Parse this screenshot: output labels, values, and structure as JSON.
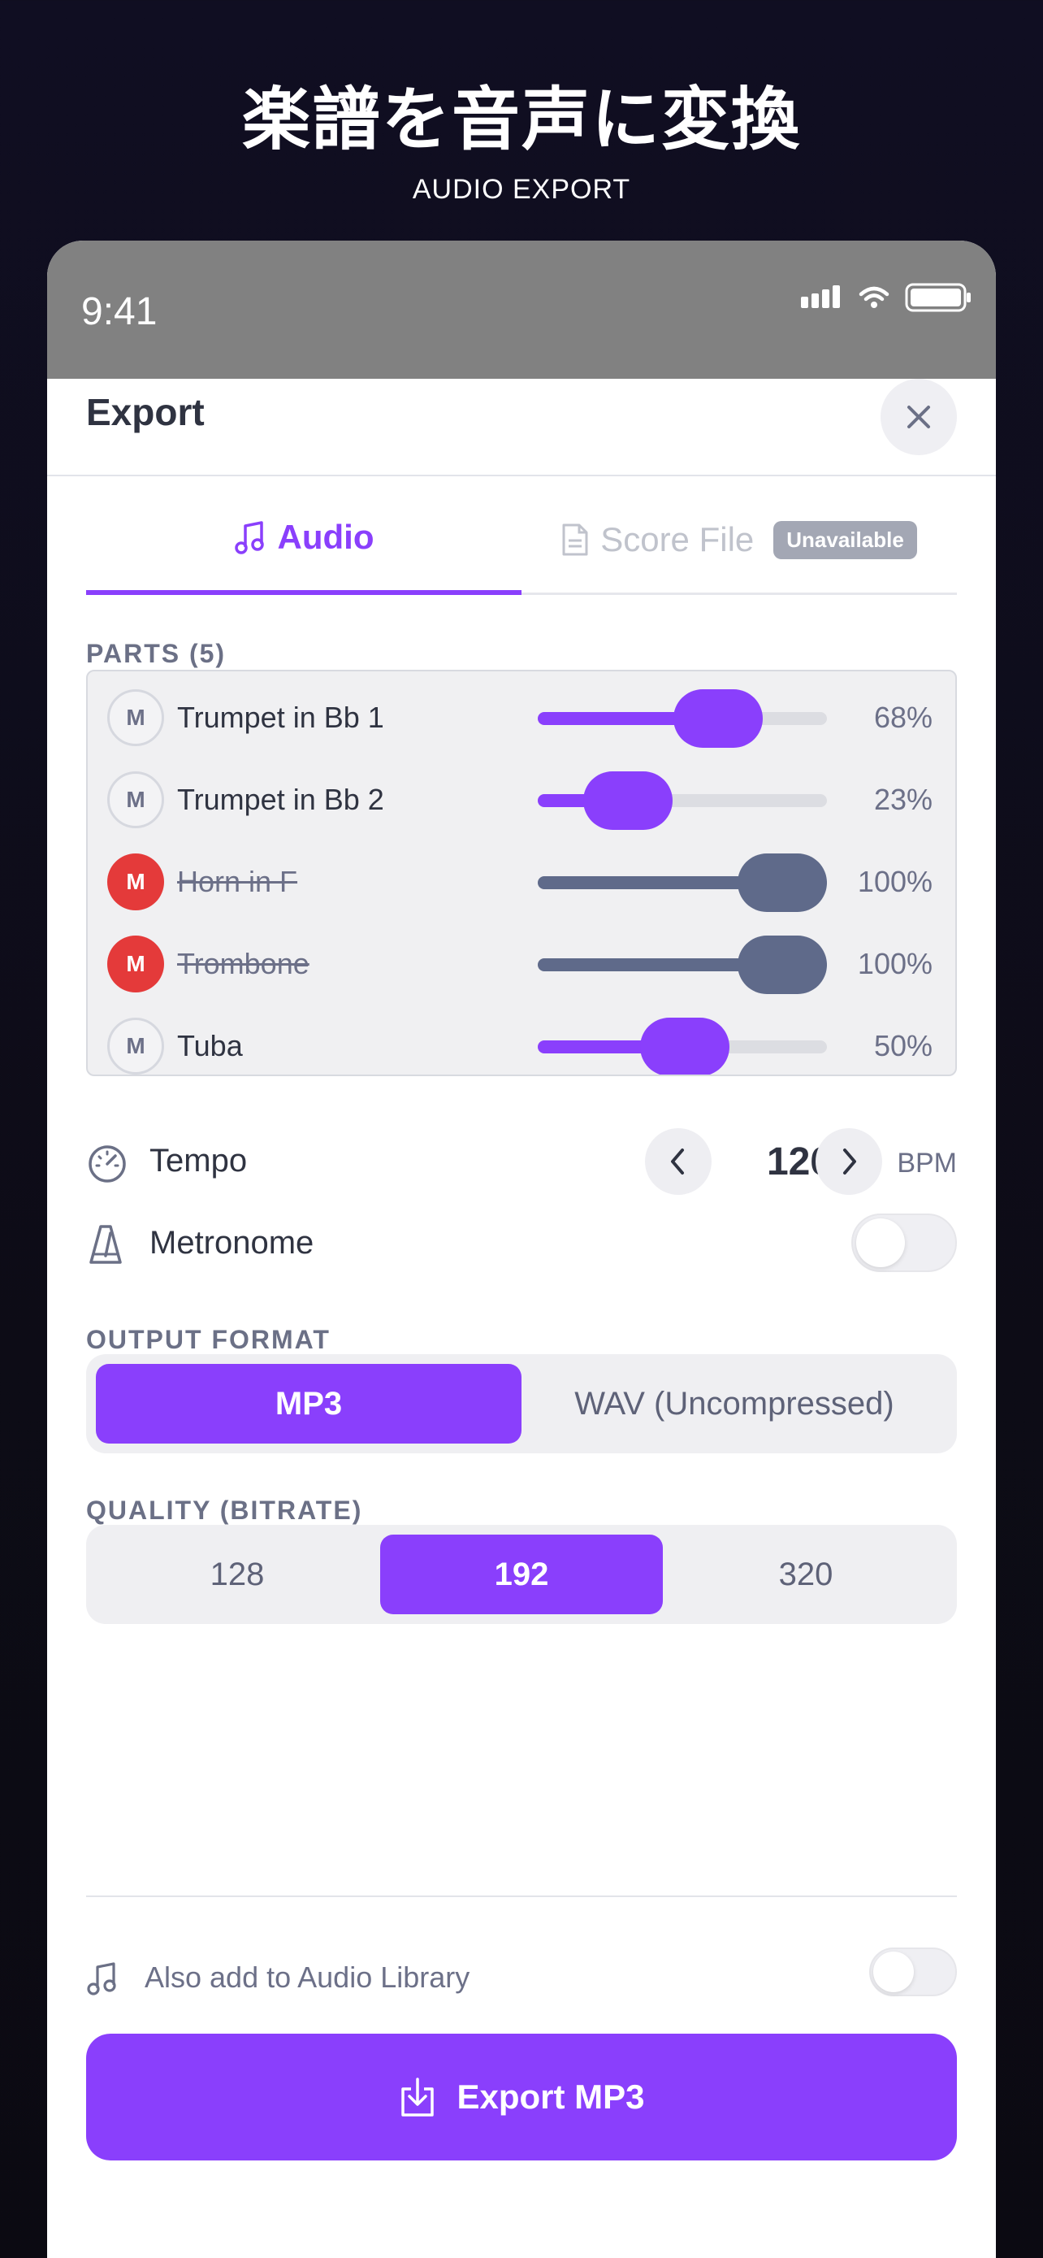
{
  "hero": {
    "title": "楽譜を音声に変換",
    "subtitle": "AUDIO EXPORT"
  },
  "status_bar": {
    "time": "9:41"
  },
  "header": {
    "title": "Export"
  },
  "tabs": {
    "audio_label": "Audio",
    "score_label": "Score File",
    "score_badge": "Unavailable"
  },
  "parts": {
    "label": "PARTS (5)",
    "items": [
      {
        "mute": "M",
        "name": "Trumpet in Bb 1",
        "volume": 68,
        "volume_text": "68%",
        "muted": false
      },
      {
        "mute": "M",
        "name": "Trumpet in Bb 2",
        "volume": 23,
        "volume_text": "23%",
        "muted": false
      },
      {
        "mute": "M",
        "name": "Horn in F",
        "volume": 100,
        "volume_text": "100%",
        "muted": true
      },
      {
        "mute": "M",
        "name": "Trombone",
        "volume": 100,
        "volume_text": "100%",
        "muted": true
      },
      {
        "mute": "M",
        "name": "Tuba",
        "volume": 50,
        "volume_text": "50%",
        "muted": false
      }
    ]
  },
  "tempo": {
    "label": "Tempo",
    "value": "126",
    "unit": "BPM"
  },
  "metronome": {
    "label": "Metronome",
    "enabled": false
  },
  "output_format": {
    "label": "OUTPUT FORMAT",
    "options": [
      "MP3",
      "WAV (Uncompressed)"
    ],
    "selected": "MP3"
  },
  "quality": {
    "label": "QUALITY (BITRATE)",
    "options": [
      "128",
      "192",
      "320"
    ],
    "selected": "192"
  },
  "library": {
    "label": "Also add to Audio Library",
    "enabled": false
  },
  "export_button": {
    "label": "Export MP3"
  },
  "colors": {
    "accent": "#8a3ffc",
    "muted_red": "#e43a3a",
    "muted_slider": "#5f6a8a"
  }
}
